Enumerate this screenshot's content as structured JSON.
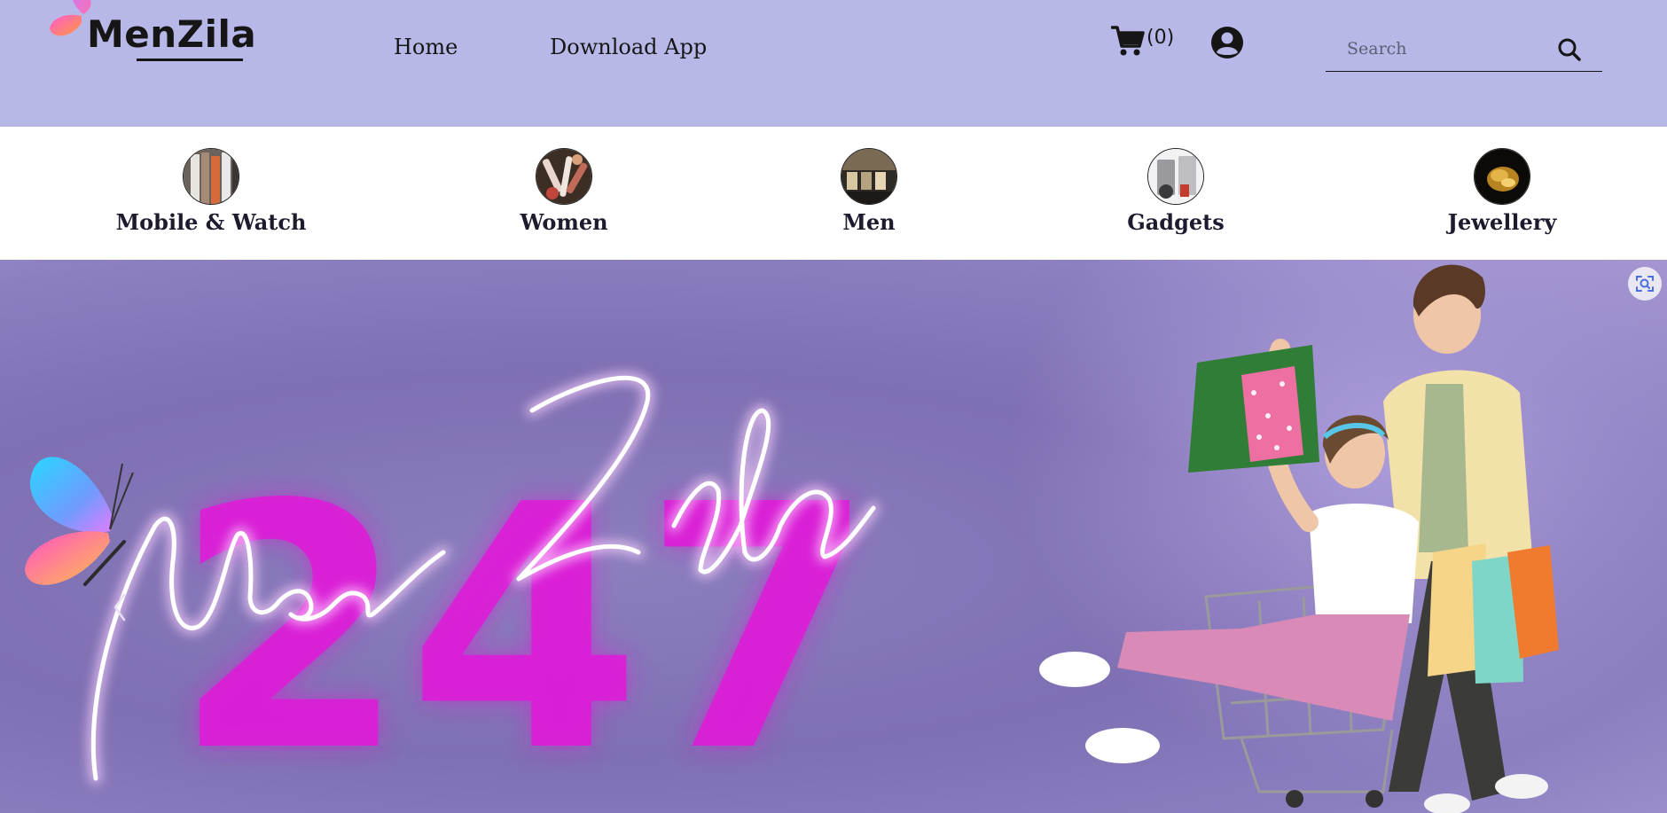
{
  "header": {
    "logo_text": "MenZila",
    "nav": {
      "home": "Home",
      "download_app": "Download App"
    },
    "cart": {
      "icon": "shopping-cart-icon",
      "count": "(0)"
    },
    "account": {
      "icon": "user-circle-icon"
    },
    "search": {
      "placeholder": "Search",
      "value": "",
      "icon": "search-icon"
    }
  },
  "categories": [
    {
      "label": "Mobile & Watch",
      "thumb": "clothing-rack"
    },
    {
      "label": "Women",
      "thumb": "cosmetics"
    },
    {
      "label": "Men",
      "thumb": "menswear-store"
    },
    {
      "label": "Gadgets",
      "thumb": "appliances"
    },
    {
      "label": "Jewellery",
      "thumb": "gold-jewellery"
    }
  ],
  "hero": {
    "neon_text": "MenZila",
    "background_text": "247",
    "carousel_prev_icon": "chevron-left-icon",
    "lens_icon": "visual-search-icon"
  },
  "colors": {
    "header_bg": "#b8b8e8",
    "hero_bg": "#8577b8",
    "neon_pink": "#e01ee0",
    "text_dark": "#161616"
  }
}
